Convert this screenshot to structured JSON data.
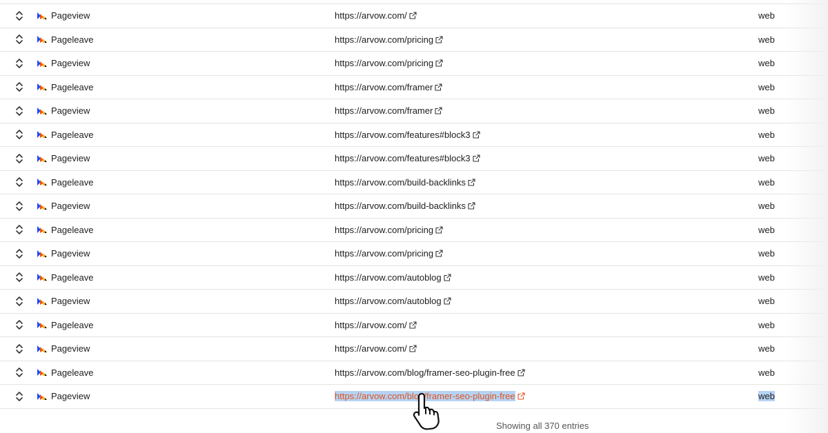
{
  "events": [
    {
      "event": "Pageview",
      "url": "https://arvow.com/",
      "lib": "web"
    },
    {
      "event": "Pageleave",
      "url": "https://arvow.com/pricing",
      "lib": "web"
    },
    {
      "event": "Pageview",
      "url": "https://arvow.com/pricing",
      "lib": "web"
    },
    {
      "event": "Pageleave",
      "url": "https://arvow.com/framer",
      "lib": "web"
    },
    {
      "event": "Pageview",
      "url": "https://arvow.com/framer",
      "lib": "web"
    },
    {
      "event": "Pageleave",
      "url": "https://arvow.com/features#block3",
      "lib": "web"
    },
    {
      "event": "Pageview",
      "url": "https://arvow.com/features#block3",
      "lib": "web"
    },
    {
      "event": "Pageleave",
      "url": "https://arvow.com/build-backlinks",
      "lib": "web"
    },
    {
      "event": "Pageview",
      "url": "https://arvow.com/build-backlinks",
      "lib": "web"
    },
    {
      "event": "Pageleave",
      "url": "https://arvow.com/pricing",
      "lib": "web"
    },
    {
      "event": "Pageview",
      "url": "https://arvow.com/pricing",
      "lib": "web"
    },
    {
      "event": "Pageleave",
      "url": "https://arvow.com/autoblog",
      "lib": "web"
    },
    {
      "event": "Pageview",
      "url": "https://arvow.com/autoblog",
      "lib": "web"
    },
    {
      "event": "Pageleave",
      "url": "https://arvow.com/",
      "lib": "web"
    },
    {
      "event": "Pageview",
      "url": "https://arvow.com/",
      "lib": "web"
    },
    {
      "event": "Pageleave",
      "url": "https://arvow.com/blog/framer-seo-plugin-free",
      "lib": "web"
    },
    {
      "event": "Pageview",
      "url": "https://arvow.com/blog/framer-seo-plugin-free",
      "lib": "web",
      "selected": true
    }
  ],
  "footer": {
    "summary": "Showing all 370 entries"
  },
  "icons": {
    "expand": "chevron-up-down-icon",
    "event": "posthog-event-icon",
    "external": "external-link-icon",
    "cursor": "hand-pointer-cursor"
  },
  "colors": {
    "link_selected": "#e0531a",
    "selection": "#b6d3f5",
    "border": "#e3e5e0"
  }
}
